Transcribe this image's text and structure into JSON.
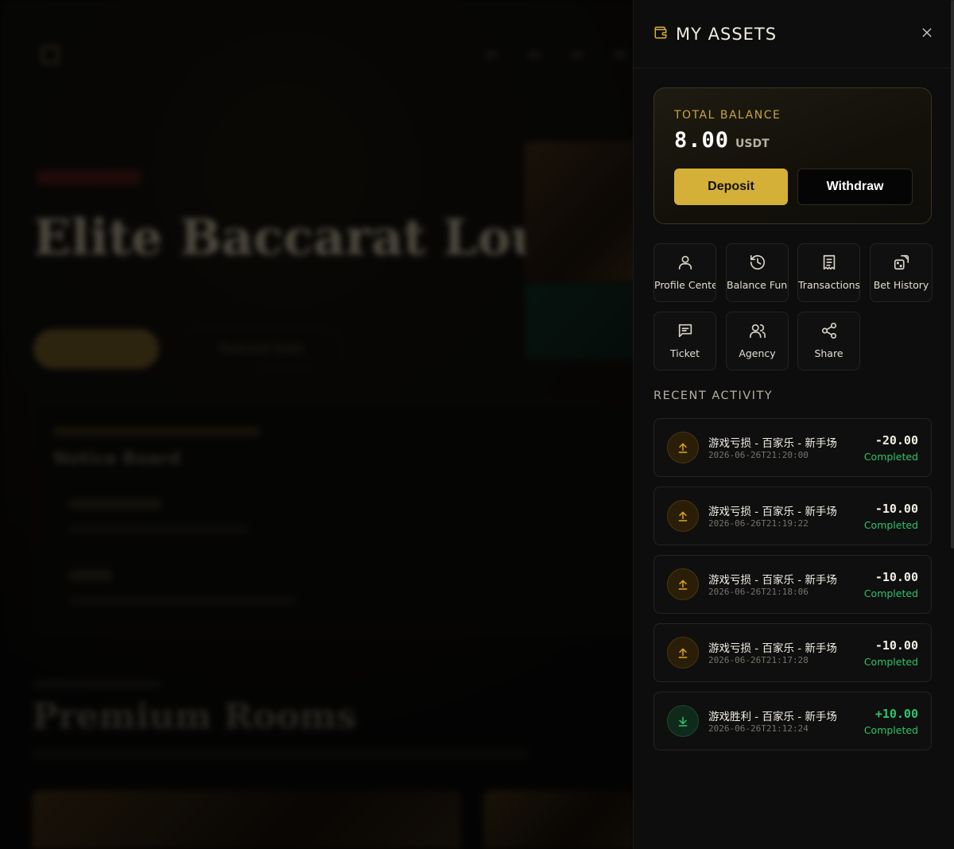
{
  "background": {
    "hero_title": "Elite Baccarat Lounge",
    "secondary_button": "Featured Seats",
    "notice_title": "Notice Board",
    "section_title": "Premium Rooms"
  },
  "drawer": {
    "title": "MY ASSETS",
    "title_icon": "wallet-icon",
    "close_icon": "close-icon"
  },
  "balance": {
    "label": "TOTAL BALANCE",
    "amount": "8.00",
    "unit": "USDT",
    "deposit_label": "Deposit",
    "withdraw_label": "Withdraw",
    "accent_color": "#d5b038"
  },
  "menu": [
    {
      "label": "Profile Center",
      "icon": "user-icon"
    },
    {
      "label": "Balance Funds",
      "icon": "history-icon"
    },
    {
      "label": "Transactions",
      "icon": "receipt-icon"
    },
    {
      "label": "Bet History",
      "icon": "dice-icon"
    },
    {
      "label": "Ticket",
      "icon": "message-icon"
    },
    {
      "label": "Agency",
      "icon": "users-icon"
    },
    {
      "label": "Share",
      "icon": "share-icon"
    }
  ],
  "recent_activity": {
    "label": "RECENT ACTIVITY",
    "items": [
      {
        "title": "游戏亏损 - 百家乐 - 新手场",
        "time": "2026-06-26T21:20:00",
        "amount": "-20.00",
        "status": "Completed",
        "direction": "out"
      },
      {
        "title": "游戏亏损 - 百家乐 - 新手场",
        "time": "2026-06-26T21:19:22",
        "amount": "-10.00",
        "status": "Completed",
        "direction": "out"
      },
      {
        "title": "游戏亏损 - 百家乐 - 新手场",
        "time": "2026-06-26T21:18:06",
        "amount": "-10.00",
        "status": "Completed",
        "direction": "out"
      },
      {
        "title": "游戏亏损 - 百家乐 - 新手场",
        "time": "2026-06-26T21:17:28",
        "amount": "-10.00",
        "status": "Completed",
        "direction": "out"
      },
      {
        "title": "游戏胜利 - 百家乐 - 新手场",
        "time": "2026-06-26T21:12:24",
        "amount": "+10.00",
        "status": "Completed",
        "direction": "in"
      }
    ]
  },
  "colors": {
    "gold": "#d5b038",
    "success": "#2ec36c"
  }
}
